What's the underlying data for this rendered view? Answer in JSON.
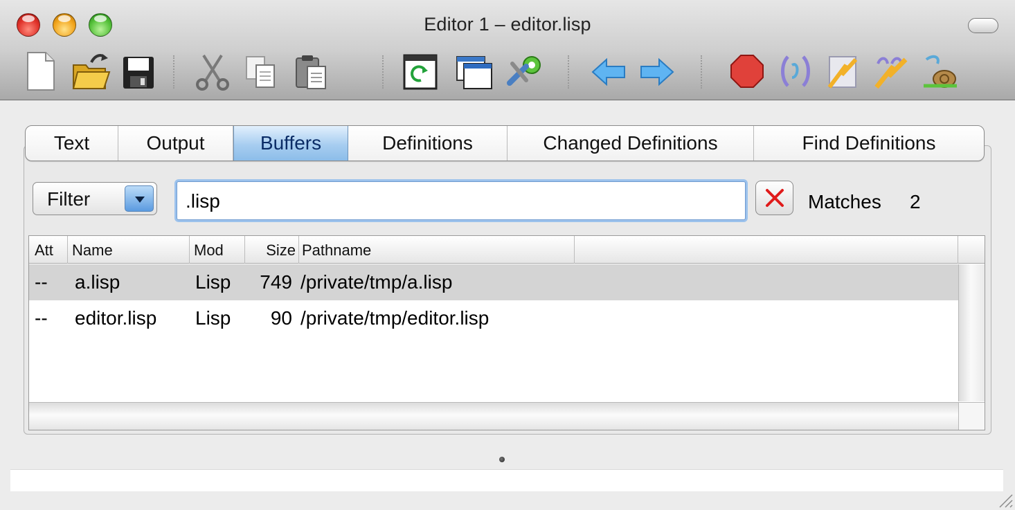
{
  "window": {
    "title": "Editor 1 – editor.lisp"
  },
  "toolbar": {
    "buttons": [
      {
        "name": "new-file-icon"
      },
      {
        "name": "open-file-icon"
      },
      {
        "name": "save-file-icon"
      },
      {
        "name": "cut-icon"
      },
      {
        "name": "copy-icon"
      },
      {
        "name": "paste-icon"
      },
      {
        "name": "evaluate-buffer-icon"
      },
      {
        "name": "new-window-icon"
      },
      {
        "name": "build-tools-icon"
      },
      {
        "name": "back-arrow-icon"
      },
      {
        "name": "forward-arrow-icon"
      },
      {
        "name": "stop-icon"
      },
      {
        "name": "inspect-expression-icon"
      },
      {
        "name": "compile-icon"
      },
      {
        "name": "compile-all-icon"
      },
      {
        "name": "step-icon"
      }
    ]
  },
  "tabs": [
    {
      "label": "Text",
      "active": false
    },
    {
      "label": "Output",
      "active": false
    },
    {
      "label": "Buffers",
      "active": true
    },
    {
      "label": "Definitions",
      "active": false
    },
    {
      "label": "Changed Definitions",
      "active": false
    },
    {
      "label": "Find Definitions",
      "active": false
    }
  ],
  "filter": {
    "mode": "Filter",
    "query": ".lisp",
    "matches_label": "Matches",
    "matches_count": "2"
  },
  "table": {
    "columns": [
      "Att",
      "Name",
      "Mod",
      "Size",
      "Pathname"
    ],
    "rows": [
      {
        "att": "--",
        "name": "a.lisp",
        "mod": "Lisp",
        "size": "749",
        "pathname": "/private/tmp/a.lisp",
        "selected": true
      },
      {
        "att": "--",
        "name": "editor.lisp",
        "mod": "Lisp",
        "size": "90",
        "pathname": "/private/tmp/editor.lisp",
        "selected": false
      }
    ]
  },
  "colors": {
    "active_tab": "#a7cdf0",
    "selected_row": "#d4d4d4",
    "focus_ring": "#9cc2ec"
  }
}
